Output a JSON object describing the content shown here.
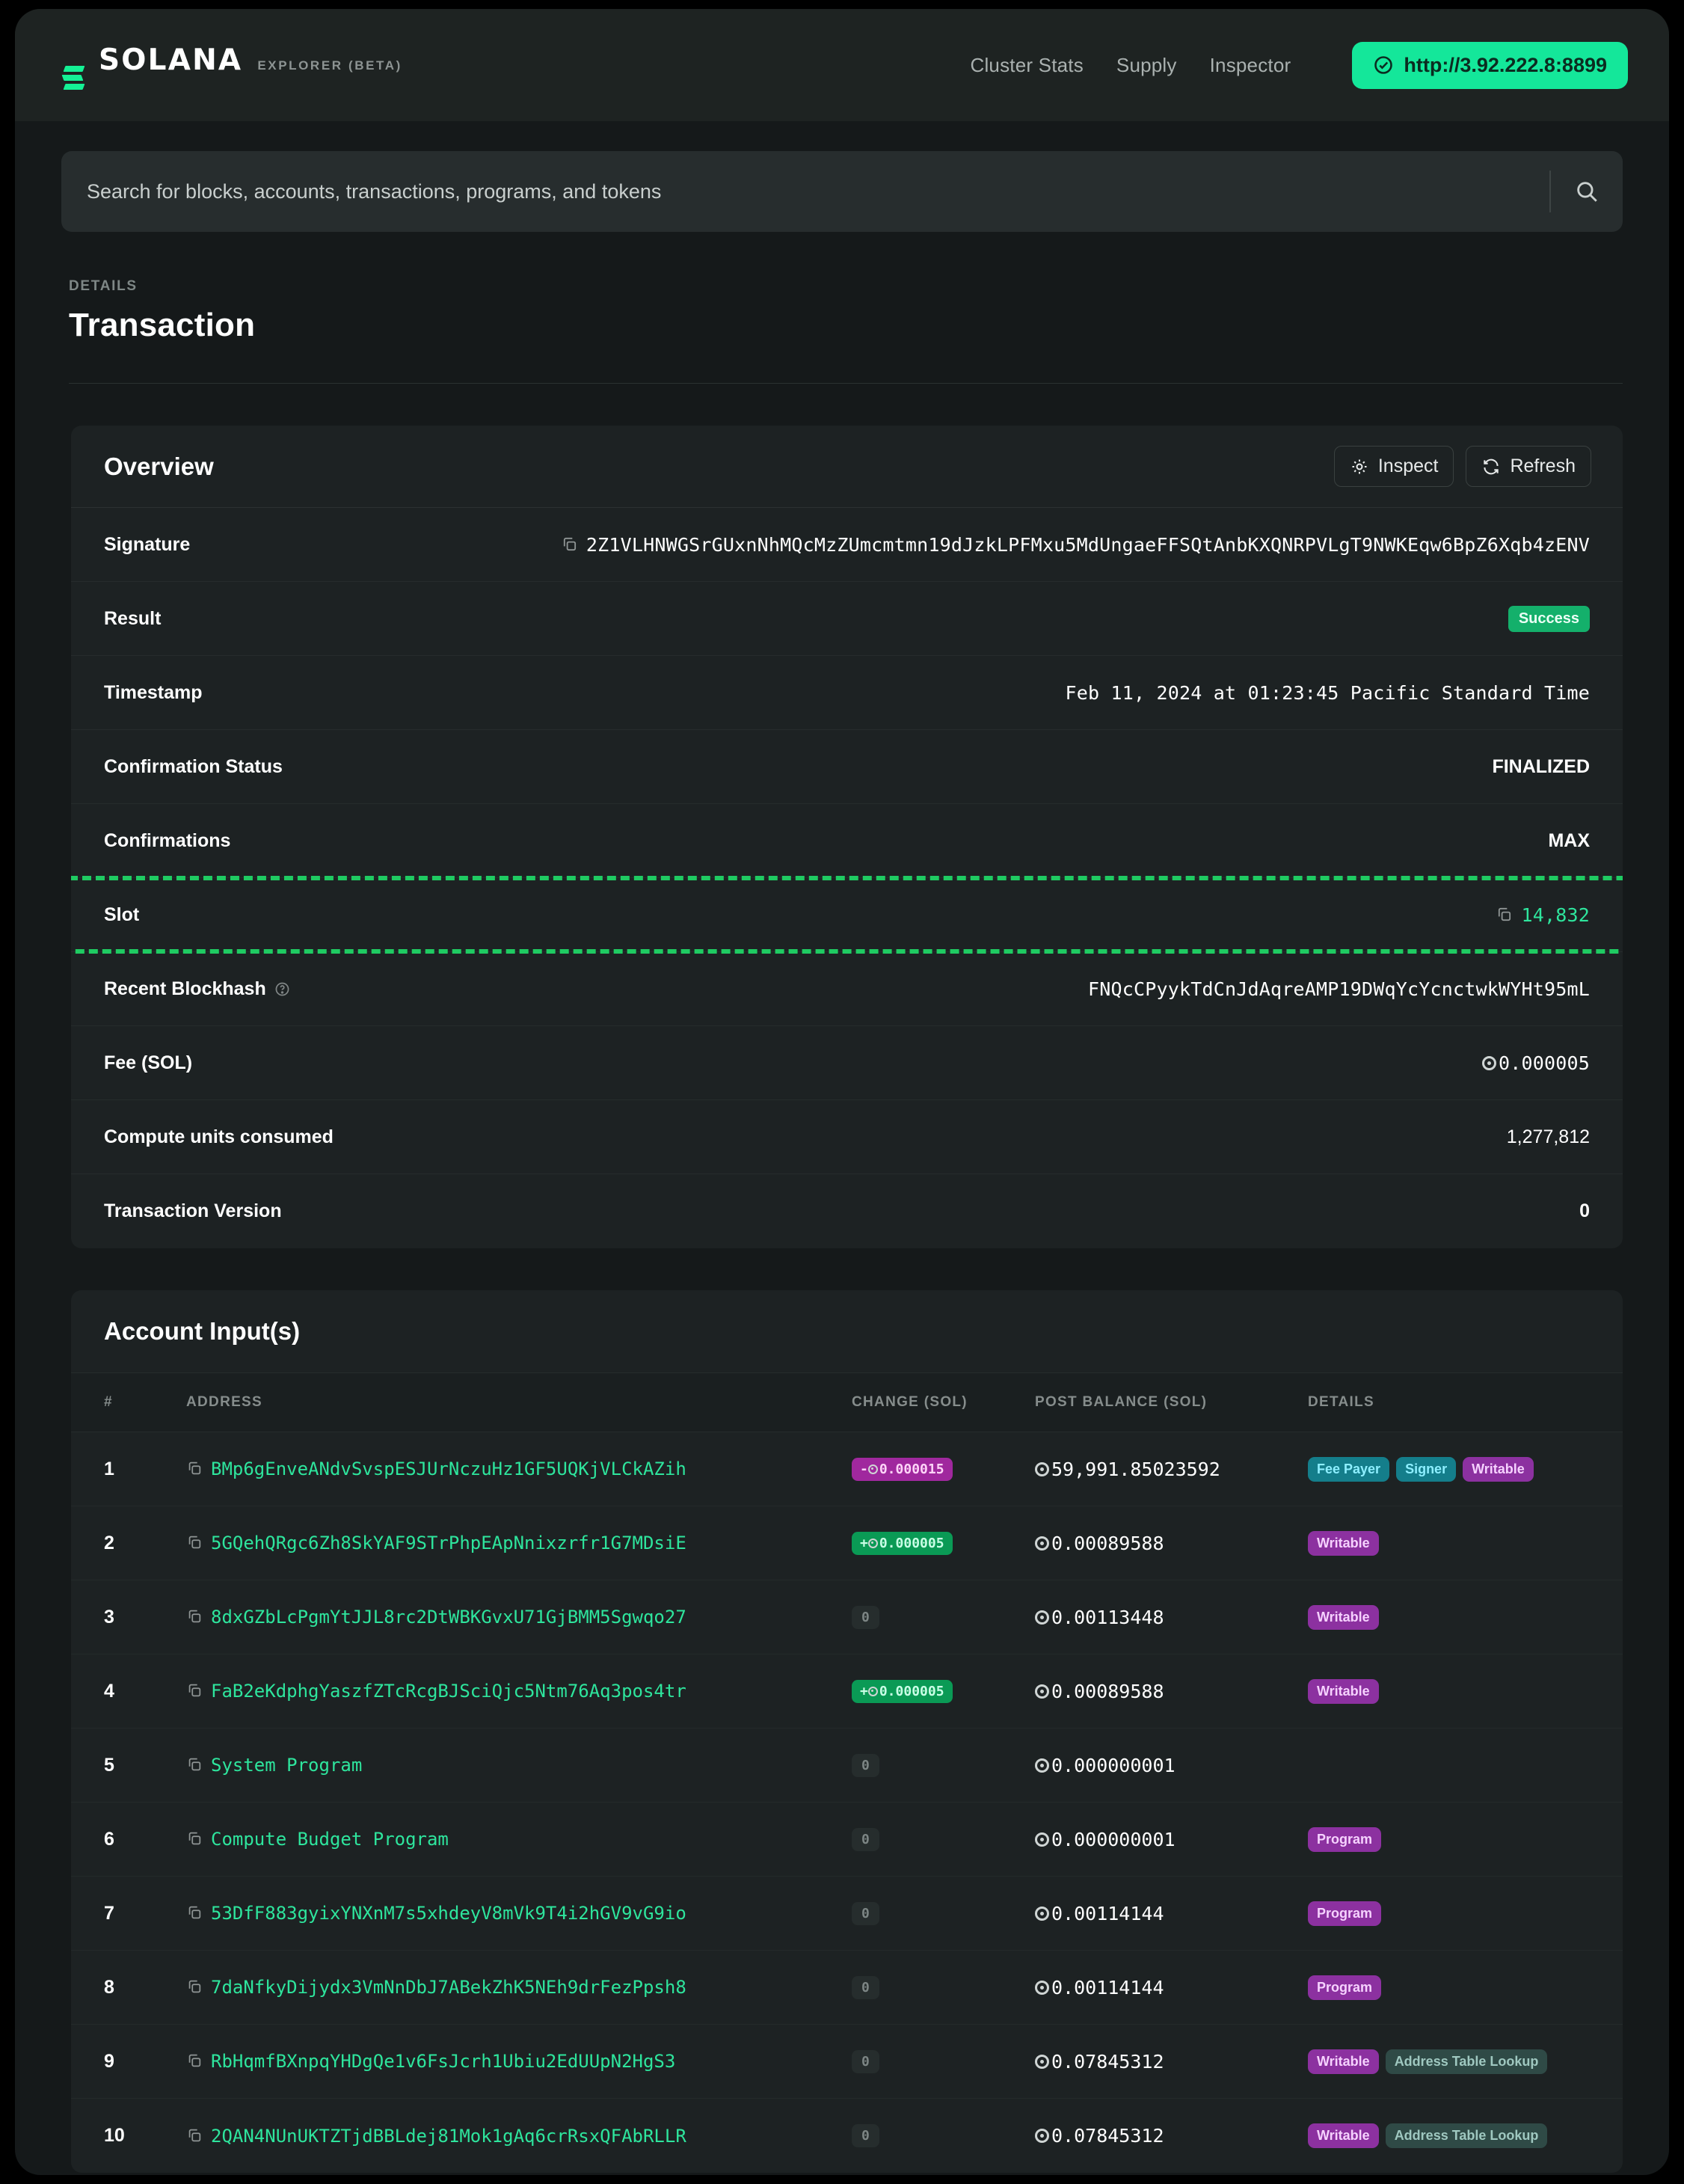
{
  "header": {
    "logo_word": "SOLANA",
    "logo_sub": "EXPLORER (BETA)",
    "nav": [
      {
        "label": "Cluster Stats"
      },
      {
        "label": "Supply"
      },
      {
        "label": "Inspector"
      }
    ],
    "cluster_pill": "http://3.92.222.8:8899",
    "accent": "#14e79a"
  },
  "search": {
    "placeholder": "Search for blocks, accounts, transactions, programs, and tokens",
    "value": ""
  },
  "page": {
    "eyebrow": "DETAILS",
    "title": "Transaction"
  },
  "overview": {
    "title": "Overview",
    "inspect_label": "Inspect",
    "refresh_label": "Refresh",
    "rows": [
      {
        "label": "Signature",
        "value": "2Z1VLHNWGSrGUxnNhMQcMzZUmcmtmn19dJzkLPFMxu5MdUngaeFFSQtAnbKXQNRPVLgT9NWKEqw6BpZ6Xqb4zENV"
      },
      {
        "label": "Result",
        "value": "Success"
      },
      {
        "label": "Timestamp",
        "value": "Feb 11, 2024 at 01:23:45 Pacific Standard Time"
      },
      {
        "label": "Confirmation Status",
        "value": "FINALIZED"
      },
      {
        "label": "Confirmations",
        "value": "MAX"
      },
      {
        "label": "Slot",
        "value": "14,832"
      },
      {
        "label": "Recent Blockhash",
        "value": "FNQcCPyykTdCnJdAqreAMP19DWqYcYcnctwkWYHt95mL"
      },
      {
        "label": "Fee (SOL)",
        "value": "0.000005"
      },
      {
        "label": "Compute units consumed",
        "value": "1,277,812"
      },
      {
        "label": "Transaction Version",
        "value": "0"
      }
    ],
    "highlighted_row": "Slot"
  },
  "accounts": {
    "title": "Account Input(s)",
    "columns": [
      "#",
      "ADDRESS",
      "CHANGE (SOL)",
      "POST BALANCE (SOL)",
      "DETAILS"
    ],
    "rows": [
      {
        "num": "1",
        "address": "BMp6gEnveANdvSvspESJUrNczuHz1GF5UQKjVLCkAZih",
        "change": "-0.000015",
        "change_type": "neg",
        "balance": "59,991.85023592",
        "tags": [
          "Fee Payer",
          "Signer",
          "Writable"
        ]
      },
      {
        "num": "2",
        "address": "5GQehQRgc6Zh8SkYAF9STrPhpEApNnixzrfr1G7MDsiE",
        "change": "+0.000005",
        "change_type": "pos",
        "balance": "0.00089588",
        "tags": [
          "Writable"
        ]
      },
      {
        "num": "3",
        "address": "8dxGZbLcPgmYtJJL8rc2DtWBKGvxU71GjBMM5Sgwqo27",
        "change": "0",
        "change_type": "zero",
        "balance": "0.00113448",
        "tags": [
          "Writable"
        ]
      },
      {
        "num": "4",
        "address": "FaB2eKdphgYaszfZTcRcgBJSciQjc5Ntm76Aq3pos4tr",
        "change": "+0.000005",
        "change_type": "pos",
        "balance": "0.00089588",
        "tags": [
          "Writable"
        ]
      },
      {
        "num": "5",
        "address": "System Program",
        "change": "0",
        "change_type": "zero",
        "balance": "0.000000001",
        "tags": []
      },
      {
        "num": "6",
        "address": "Compute Budget Program",
        "change": "0",
        "change_type": "zero",
        "balance": "0.000000001",
        "tags": [
          "Program"
        ]
      },
      {
        "num": "7",
        "address": "53DfF883gyixYNXnM7s5xhdeyV8mVk9T4i2hGV9vG9io",
        "change": "0",
        "change_type": "zero",
        "balance": "0.00114144",
        "tags": [
          "Program"
        ]
      },
      {
        "num": "8",
        "address": "7daNfkyDijydx3VmNnDbJ7ABekZhK5NEh9drFezPpsh8",
        "change": "0",
        "change_type": "zero",
        "balance": "0.00114144",
        "tags": [
          "Program"
        ]
      },
      {
        "num": "9",
        "address": "RbHqmfBXnpqYHDgQe1v6FsJcrh1Ubiu2EdUUpN2HgS3",
        "change": "0",
        "change_type": "zero",
        "balance": "0.07845312",
        "tags": [
          "Writable",
          "Address Table Lookup"
        ]
      },
      {
        "num": "10",
        "address": "2QAN4NUnUKTZTjdBBLdej81Mok1gAq6crRsxQFAbRLLR",
        "change": "0",
        "change_type": "zero",
        "balance": "0.07845312",
        "tags": [
          "Writable",
          "Address Table Lookup"
        ]
      }
    ]
  },
  "icons": {
    "copy": "copy-icon",
    "search": "search-icon",
    "gear": "gear-icon",
    "refresh": "refresh-icon",
    "help": "help-circle-icon",
    "check_circle": "check-circle-icon"
  },
  "colors": {
    "accent_green": "#14f195",
    "link_green": "#2ee59d",
    "highlight_dashed": "#1fcb62",
    "badge_success": "#14b06b",
    "tag_writable": "#8c31a0",
    "tag_signer": "#147e8b"
  }
}
